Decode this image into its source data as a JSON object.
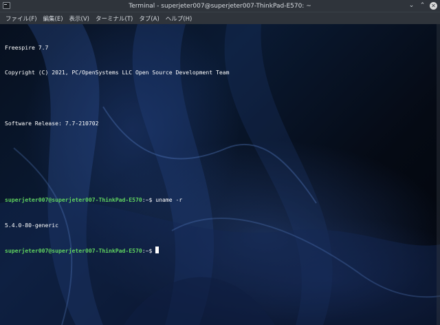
{
  "window": {
    "title": "Terminal - superjeter007@superjeter007-ThinkPad-E570: ~"
  },
  "menu": [
    {
      "label": "ファイル(F)"
    },
    {
      "label": "編集(E)"
    },
    {
      "label": "表示(V)"
    },
    {
      "label": "ターミナル(T)"
    },
    {
      "label": "タブ(A)"
    },
    {
      "label": "ヘルプ(H)"
    }
  ],
  "terminal": {
    "banner": {
      "line1": "Freespire 7.7",
      "line2": "Copyright (C) 2021, PC/OpenSystems LLC Open Source Development Team",
      "line3": "Software Release: 7.7-210702"
    },
    "prompt1": {
      "user_host": "superjeter007@superjeter007-ThinkPad-E570",
      "path": ":~$",
      "command": " uname -r"
    },
    "output1": "5.4.0-80-generic",
    "prompt2": {
      "user_host": "superjeter007@superjeter007-ThinkPad-E570",
      "path": ":~$",
      "command": " "
    }
  },
  "icons": {
    "app": "terminal-icon",
    "minimize": "minimize-icon",
    "maximize": "maximize-icon",
    "close": "close-icon"
  },
  "colors": {
    "titlebar_bg": "#2f343b",
    "prompt": "#5fd35f",
    "text": "#ffffff",
    "background": "#0a1a33"
  }
}
